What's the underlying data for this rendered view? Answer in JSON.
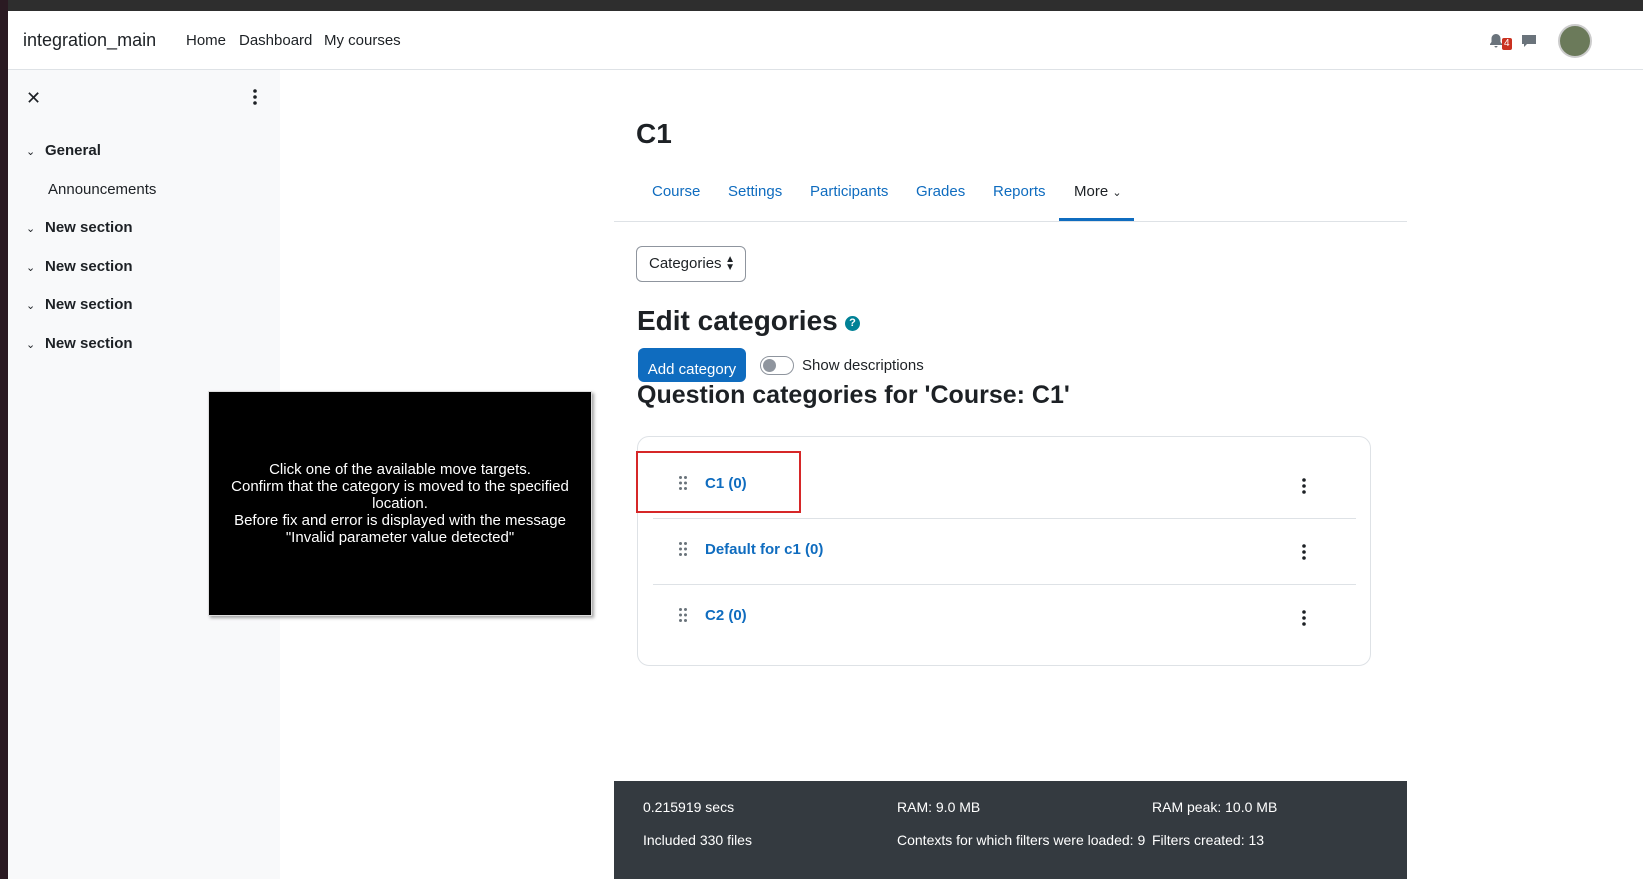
{
  "navbar": {
    "brand": "integration_main",
    "links": [
      "Home",
      "Dashboard",
      "My courses"
    ],
    "notification_count": "4"
  },
  "drawer": {
    "close_icon": "close-icon",
    "sections": [
      {
        "label": "General",
        "items": [
          "Announcements"
        ]
      },
      {
        "label": "New section",
        "items": []
      },
      {
        "label": "New section",
        "items": []
      },
      {
        "label": "New section",
        "items": []
      },
      {
        "label": "New section",
        "items": []
      }
    ]
  },
  "page": {
    "title": "C1",
    "tabs": [
      "Course",
      "Settings",
      "Participants",
      "Grades",
      "Reports",
      "More"
    ],
    "active_tab": "More",
    "select_value": "Categories",
    "heading": "Edit categories",
    "add_button": "Add category",
    "toggle_label": "Show descriptions",
    "subheading": "Question categories for 'Course: C1'",
    "categories": [
      {
        "label": "C1 (0)"
      },
      {
        "label": "Default for c1 (0)"
      },
      {
        "label": "C2 (0)"
      }
    ]
  },
  "overlay": {
    "lines": [
      "Click one of the available move targets.",
      "Confirm that the category is moved to the specified location.",
      "Before fix and error is displayed with the message \"Invalid parameter value detected\""
    ]
  },
  "footer": {
    "row1": [
      "0.215919 secs",
      "RAM: 9.0 MB",
      "RAM peak: 10.0 MB"
    ],
    "row2": [
      "Included 330 files",
      "Contexts for which filters were loaded: 9",
      "Filters created: 13"
    ]
  },
  "colors": {
    "link": "#0f6cbf",
    "primary": "#0f6cbf",
    "highlight": "#d62728",
    "footer_bg": "#343a40",
    "help": "#008196"
  }
}
